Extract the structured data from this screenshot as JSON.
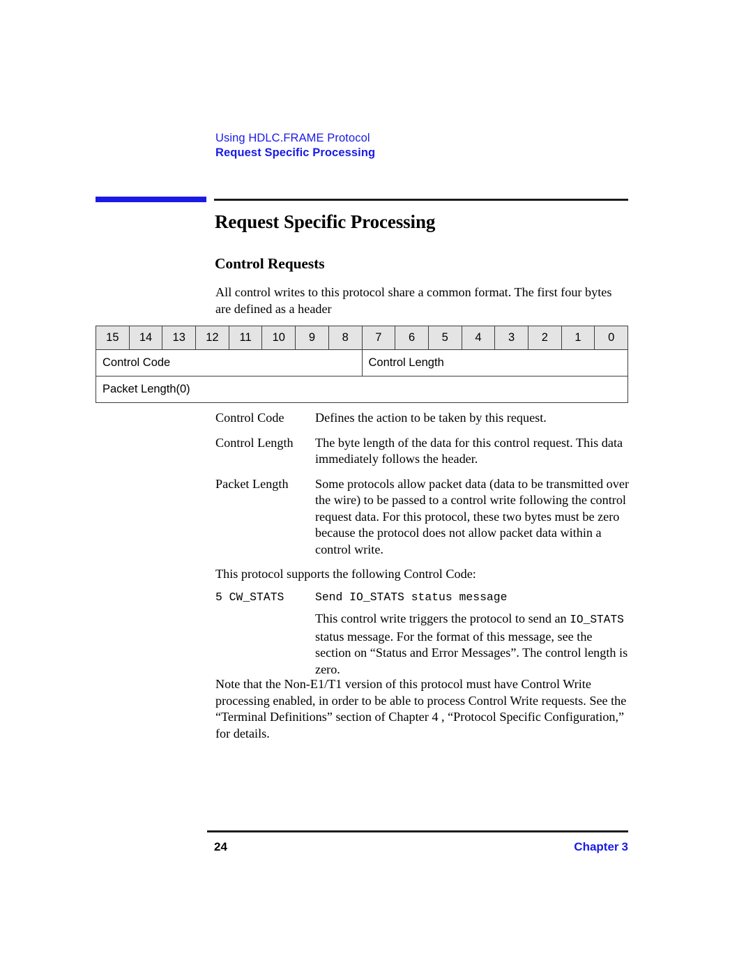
{
  "header": {
    "running_title": "Using HDLC.FRAME Protocol",
    "running_section": "Request Specific Processing"
  },
  "headings": {
    "h1": "Request Specific Processing",
    "h2": "Control Requests"
  },
  "body": {
    "intro": "All control writes to this protocol share a common format. The first four bytes are defined as a header",
    "supports": "This protocol supports the following Control Code:",
    "note": "Note that the Non-E1/T1 version of this protocol must have Control Write processing enabled, in order to be able to process Control Write requests. See the “Terminal Definitions” section of Chapter 4 , “Protocol Specific Configuration,” for details."
  },
  "bit_table": {
    "bits": [
      "15",
      "14",
      "13",
      "12",
      "11",
      "10",
      "9",
      "8",
      "7",
      "6",
      "5",
      "4",
      "3",
      "2",
      "1",
      "0"
    ],
    "field_row": [
      {
        "label": "Control Code",
        "span": 8
      },
      {
        "label": "Control Length",
        "span": 8
      }
    ],
    "packet_row": [
      {
        "label": "Packet Length(0)",
        "span": 16
      }
    ]
  },
  "definitions": [
    {
      "term": "Control Code",
      "desc": "Defines the action to be taken by this request."
    },
    {
      "term": "Control Length",
      "desc": "The byte length of the data for this control request. This data immediately follows the header."
    },
    {
      "term": "Packet Length",
      "desc": "Some protocols allow packet data (data to be transmitted over the wire) to be passed to a control write following the control request data. For this protocol, these two bytes must be zero because the protocol does not allow packet data within a control write."
    }
  ],
  "control_code": {
    "term": "5 CW_STATS",
    "summary": "Send IO_STATS status message",
    "note_part1": "This control write triggers the protocol to send an ",
    "note_mono": "IO_STATS",
    "note_part2": " status message. For the format of this message, see the section on “Status and Error Messages”. The control length is zero."
  },
  "footer": {
    "page_number": "24",
    "chapter_label": "Chapter",
    "chapter_number": "3"
  },
  "colors": {
    "accent_blue": "#1a1ae6",
    "rule_black": "#1c1c1c",
    "table_header_fill": "#e4e4e4",
    "table_border": "#3c3c3c"
  }
}
